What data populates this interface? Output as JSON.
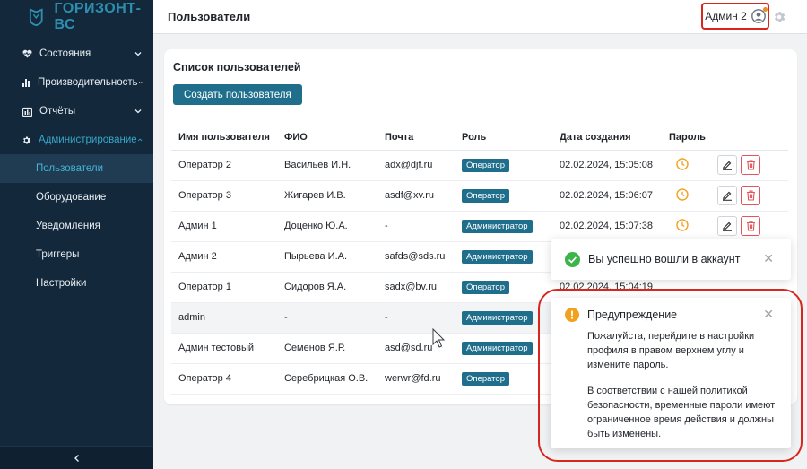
{
  "app": {
    "logo_text": "ГОРИЗОНТ-ВС"
  },
  "sidebar": {
    "items": [
      {
        "label": "Состояния",
        "icon": "heart-pulse-icon"
      },
      {
        "label": "Производительность",
        "icon": "bar-chart-icon"
      },
      {
        "label": "Отчёты",
        "icon": "report-icon"
      },
      {
        "label": "Администрирование",
        "icon": "gear-icon"
      }
    ],
    "subitems": [
      {
        "label": "Пользователи"
      },
      {
        "label": "Оборудование"
      },
      {
        "label": "Уведомления"
      },
      {
        "label": "Триггеры"
      },
      {
        "label": "Настройки"
      }
    ],
    "collapse_glyph": "<"
  },
  "header": {
    "title": "Пользователи",
    "user_name": "Админ 2"
  },
  "card": {
    "title": "Список пользователей",
    "create_label": "Создать пользователя",
    "columns": [
      "Имя пользователя",
      "ФИО",
      "Почта",
      "Роль",
      "Дата создания",
      "Пароль"
    ],
    "rows": [
      {
        "username": "Оператор 2",
        "fio": "Васильев И.Н.",
        "email": "adx@djf.ru",
        "role": "Оператор",
        "date": "02.02.2024, 15:05:08"
      },
      {
        "username": "Оператор 3",
        "fio": "Жигарев И.В.",
        "email": "asdf@xv.ru",
        "role": "Оператор",
        "date": "02.02.2024, 15:06:07"
      },
      {
        "username": "Админ 1",
        "fio": "Доценко Ю.А.",
        "email": "-",
        "role": "Администратор",
        "date": "02.02.2024, 15:07:38"
      },
      {
        "username": "Админ 2",
        "fio": "Пырьева И.А.",
        "email": "safds@sds.ru",
        "role": "Администратор",
        "date": ""
      },
      {
        "username": "Оператор 1",
        "fio": "Сидоров Я.А.",
        "email": "sadx@bv.ru",
        "role": "Оператор",
        "date": "02.02.2024, 15:04:19"
      },
      {
        "username": "admin",
        "fio": "-",
        "email": "-",
        "role": "Администратор",
        "date": ""
      },
      {
        "username": "Админ тестовый",
        "fio": "Семенов Я.Р.",
        "email": "asd@sd.ru",
        "role": "Администратор",
        "date": ""
      },
      {
        "username": "Оператор 4",
        "fio": "Серебрицкая О.В.",
        "email": "werwr@fd.ru",
        "role": "Оператор",
        "date": ""
      }
    ]
  },
  "toasts": {
    "success": {
      "text": "Вы успешно вошли в аккаунт"
    },
    "warning": {
      "title": "Предупреждение",
      "body1": "Пожалуйста, перейдите в настройки профиля в правом верхнем углу и измените пароль.",
      "body2": "В соответствии с нашей политикой безопасности, временные пароли имеют ограниченное время действия и должны быть изменены."
    },
    "close_glyph": "✕"
  },
  "colors": {
    "sidebar_bg": "#13283a",
    "accent": "#1f6e8c",
    "warning": "#f2a11e",
    "success": "#3bb54a",
    "delete": "#e0565a",
    "highlight_outline": "#d9261c"
  }
}
